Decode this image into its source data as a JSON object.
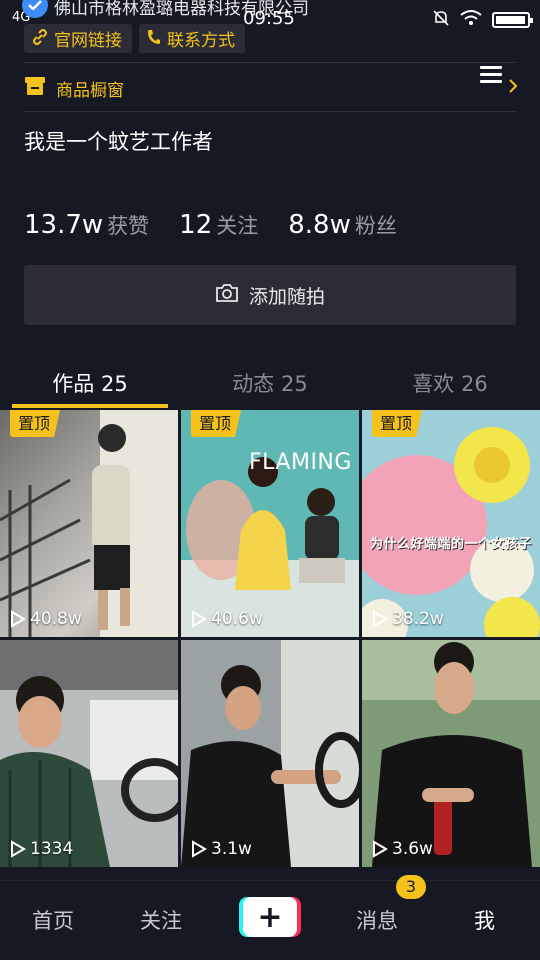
{
  "status_bar": {
    "network": "4G",
    "company": "佛山市格林盈璐电器科技有限公司",
    "time": "09:55",
    "battery_level": 0.95
  },
  "links": {
    "website": "官网链接",
    "contact": "联系方式"
  },
  "shop": {
    "label": "商品橱窗"
  },
  "bio": "我是一个蚊艺工作者",
  "stats": {
    "likes_num": "13.7w",
    "likes_label": "获赞",
    "following_num": "12",
    "following_label": "关注",
    "fans_num": "8.8w",
    "fans_label": "粉丝"
  },
  "add_button": {
    "label": "添加随拍"
  },
  "tabs": [
    {
      "label": "作品 25"
    },
    {
      "label": "动态 25"
    },
    {
      "label": "喜欢 26"
    }
  ],
  "pin_label": "置顶",
  "videos": [
    {
      "views": "40.8w",
      "pinned": true
    },
    {
      "views": "40.6w",
      "pinned": true,
      "overlay": "FLAMING"
    },
    {
      "views": "38.2w",
      "pinned": true,
      "overlay": "为什么好端端的一个女孩子"
    },
    {
      "views": "1334"
    },
    {
      "views": "3.1w"
    },
    {
      "views": "3.6w"
    }
  ],
  "bottom_nav": {
    "home": "首页",
    "follow": "关注",
    "plus": "+",
    "messages": "消息",
    "messages_badge": "3",
    "me": "我"
  },
  "colors": {
    "background": "#161823",
    "accent_yellow": "#f5c21b",
    "card": "#2b2c35"
  }
}
